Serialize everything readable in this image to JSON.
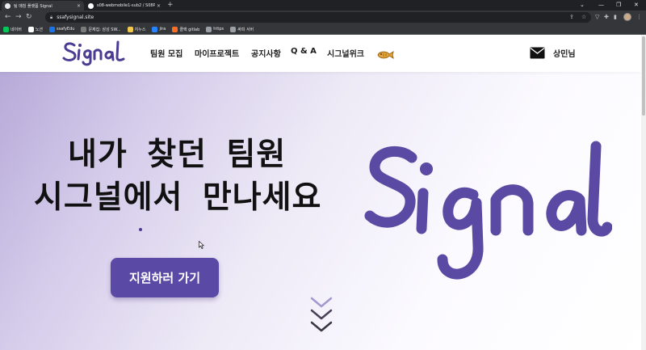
{
  "browser": {
    "tabs": [
      {
        "title": "팀 매칭 플랫폼 Signal",
        "active": true
      },
      {
        "title": "s08-webmobile1-sub2 / S08P1…",
        "active": false
      }
    ],
    "url": "ssafysignal.site",
    "bookmarks": [
      {
        "label": "네이버",
        "color": "#03c75a"
      },
      {
        "label": "노션",
        "color": "#ffffff"
      },
      {
        "label": "ssafyEdu",
        "color": "#1a73e8"
      },
      {
        "label": "문제집: 삼성 SW...",
        "color": "#7b7b7b"
      },
      {
        "label": "지누스",
        "color": "#f2c94c"
      },
      {
        "label": "jira",
        "color": "#2684ff"
      },
      {
        "label": "클랙 gitlab",
        "color": "#fc6d26"
      },
      {
        "label": "https",
        "color": "#9aa0a6"
      },
      {
        "label": "싸피 서버",
        "color": "#9aa0a6"
      }
    ]
  },
  "site": {
    "nav": {
      "menu": [
        "팀원 모집",
        "마이프로젝트",
        "공지사항",
        "Q & A",
        "시그널위크"
      ],
      "username": "상민님"
    },
    "hero": {
      "line1": "내가 찾던 팀원",
      "line2": "시그널에서 만나세요",
      "cta": "지원하러 가기"
    },
    "colors": {
      "brand": "#5b49a6",
      "logo": "#4b3c92"
    }
  }
}
